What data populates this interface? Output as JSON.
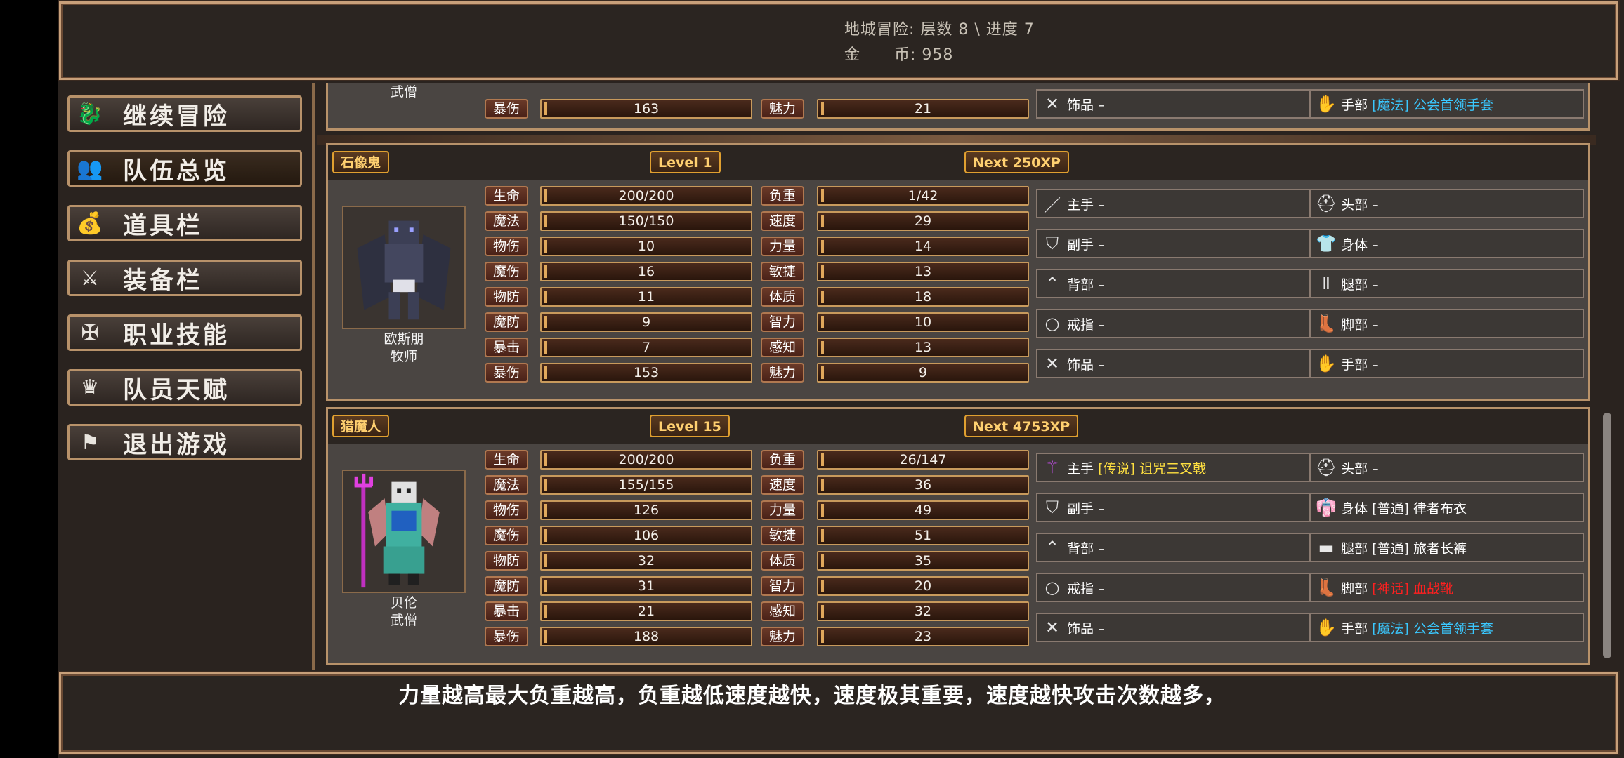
{
  "header": {
    "line1": "地城冒险: 层数 8 \\ 进度 7",
    "line2": "金      币: 958"
  },
  "menu": [
    {
      "label": "继续冒险",
      "icon": "dragon-icon"
    },
    {
      "label": "队伍总览",
      "icon": "party-icon",
      "selected": true
    },
    {
      "label": "道具栏",
      "icon": "bag-icon"
    },
    {
      "label": "装备栏",
      "icon": "weapon-shield-icon"
    },
    {
      "label": "职业技能",
      "icon": "winged-sword-icon"
    },
    {
      "label": "队员天赋",
      "icon": "laurel-icon"
    },
    {
      "label": "退出游戏",
      "icon": "flag-icon"
    }
  ],
  "partial_card": {
    "class_name": "武僧",
    "stats": [
      {
        "label": "暴伤",
        "value": "163"
      },
      {
        "label": "魅力",
        "value": "21"
      }
    ],
    "equip_left": {
      "slot": "饰品",
      "item": "–",
      "icon": "crossed-tools-icon"
    },
    "equip_right": {
      "slot": "手部",
      "tag": "[魔法]",
      "item": "公会首领手套",
      "icon": "gloves-icon",
      "tag_color": "#3ac8ff"
    }
  },
  "characters": [
    {
      "title": "石像鬼",
      "level": "Level 1",
      "next": "Next 250XP",
      "name": "欧斯朋",
      "class_name": "牧师",
      "stats_left": [
        {
          "label": "生命",
          "value": "200/200"
        },
        {
          "label": "魔法",
          "value": "150/150"
        },
        {
          "label": "物伤",
          "value": "10"
        },
        {
          "label": "魔伤",
          "value": "16"
        },
        {
          "label": "物防",
          "value": "11"
        },
        {
          "label": "魔防",
          "value": "9"
        },
        {
          "label": "暴击",
          "value": "7"
        },
        {
          "label": "暴伤",
          "value": "153"
        }
      ],
      "stats_right": [
        {
          "label": "负重",
          "value": "1/42"
        },
        {
          "label": "速度",
          "value": "29"
        },
        {
          "label": "力量",
          "value": "14"
        },
        {
          "label": "敏捷",
          "value": "13"
        },
        {
          "label": "体质",
          "value": "18"
        },
        {
          "label": "智力",
          "value": "10"
        },
        {
          "label": "感知",
          "value": "13"
        },
        {
          "label": "魅力",
          "value": "9"
        }
      ],
      "equip_left": [
        {
          "slot": "主手",
          "item": "–",
          "icon": "sword-icon"
        },
        {
          "slot": "副手",
          "item": "–",
          "icon": "shield-icon"
        },
        {
          "slot": "背部",
          "item": "–",
          "icon": "cape-icon"
        },
        {
          "slot": "戒指",
          "item": "–",
          "icon": "ring-icon"
        },
        {
          "slot": "饰品",
          "item": "–",
          "icon": "crossed-tools-icon"
        }
      ],
      "equip_right": [
        {
          "slot": "头部",
          "item": "–",
          "icon": "helmet-icon"
        },
        {
          "slot": "身体",
          "item": "–",
          "icon": "armor-icon"
        },
        {
          "slot": "腿部",
          "item": "–",
          "icon": "leggings-icon"
        },
        {
          "slot": "脚部",
          "item": "–",
          "icon": "boots-icon"
        },
        {
          "slot": "手部",
          "item": "–",
          "icon": "gloves-icon"
        }
      ]
    },
    {
      "title": "猎魔人",
      "level": "Level 15",
      "next": "Next 4753XP",
      "name": "贝伦",
      "class_name": "武僧",
      "stats_left": [
        {
          "label": "生命",
          "value": "200/200"
        },
        {
          "label": "魔法",
          "value": "155/155"
        },
        {
          "label": "物伤",
          "value": "126"
        },
        {
          "label": "魔伤",
          "value": "106"
        },
        {
          "label": "物防",
          "value": "32"
        },
        {
          "label": "魔防",
          "value": "31"
        },
        {
          "label": "暴击",
          "value": "21"
        },
        {
          "label": "暴伤",
          "value": "188"
        }
      ],
      "stats_right": [
        {
          "label": "负重",
          "value": "26/147"
        },
        {
          "label": "速度",
          "value": "36"
        },
        {
          "label": "力量",
          "value": "49"
        },
        {
          "label": "敏捷",
          "value": "51"
        },
        {
          "label": "体质",
          "value": "35"
        },
        {
          "label": "智力",
          "value": "20"
        },
        {
          "label": "感知",
          "value": "32"
        },
        {
          "label": "魅力",
          "value": "23"
        }
      ],
      "equip_left": [
        {
          "slot": "主手",
          "tag": "[传说]",
          "item": "诅咒三叉戟",
          "icon": "trident-icon",
          "color": "#ffe040"
        },
        {
          "slot": "副手",
          "item": "–",
          "icon": "shield-icon"
        },
        {
          "slot": "背部",
          "item": "–",
          "icon": "cape-icon"
        },
        {
          "slot": "戒指",
          "item": "–",
          "icon": "ring-icon"
        },
        {
          "slot": "饰品",
          "item": "–",
          "icon": "crossed-tools-icon"
        }
      ],
      "equip_right": [
        {
          "slot": "头部",
          "item": "–",
          "icon": "helmet-icon"
        },
        {
          "slot": "身体",
          "tag": "[普通]",
          "item": "律者布衣",
          "icon": "robe-icon",
          "color": "#ffffff"
        },
        {
          "slot": "腿部",
          "tag": "[普通]",
          "item": "旅者长裤",
          "icon": "pants-icon",
          "color": "#ffffff"
        },
        {
          "slot": "脚部",
          "tag": "[神话]",
          "item": "血战靴",
          "icon": "boots-icon",
          "color": "#ff2020"
        },
        {
          "slot": "手部",
          "tag": "[魔法]",
          "item": "公会首领手套",
          "icon": "gloves-icon",
          "color": "#3ac8ff"
        }
      ]
    }
  ],
  "footer": {
    "tip": "力量越高最大负重越高，负重越低速度越快，速度极其重要，速度越快攻击次数越多，"
  },
  "colors": {
    "legendary": "#ffe040",
    "common": "#ffffff",
    "mythic": "#ff2020",
    "magic": "#3ac8ff",
    "gold_tag": "#ffd070"
  }
}
